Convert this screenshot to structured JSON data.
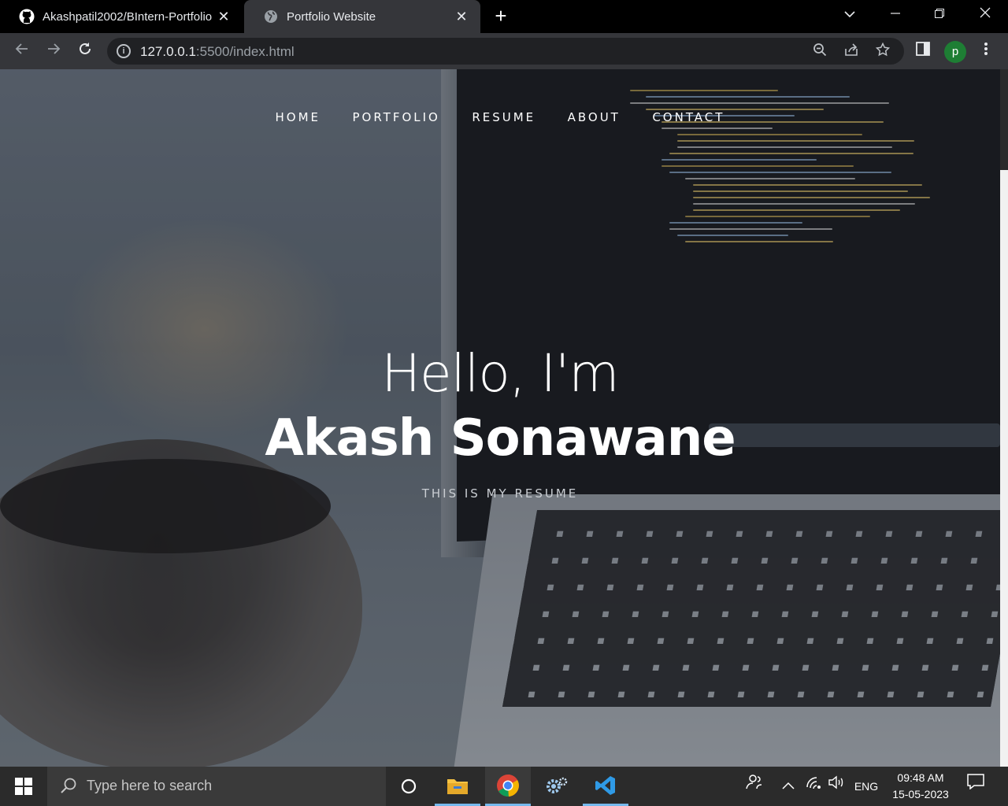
{
  "browser": {
    "tabs": [
      {
        "title": "Akashpatil2002/BIntern-Portfolio",
        "icon": "github-icon"
      },
      {
        "title": "Portfolio Website",
        "icon": "globe-icon"
      }
    ],
    "url_host": "127.0.0.1",
    "url_rest": ":5500/index.html",
    "profile_initial": "p"
  },
  "page": {
    "nav": [
      "HOME",
      "PORTFOLIO",
      "RESUME",
      "ABOUT",
      "CONTACT"
    ],
    "greeting": "Hello, I'm",
    "name": "Akash Sonawane",
    "tagline": "THIS IS MY RESUME"
  },
  "taskbar": {
    "search_placeholder": "Type here to search",
    "language": "ENG",
    "time": "09:48 AM",
    "date": "15-05-2023",
    "accent_color": "#76b9ed"
  }
}
